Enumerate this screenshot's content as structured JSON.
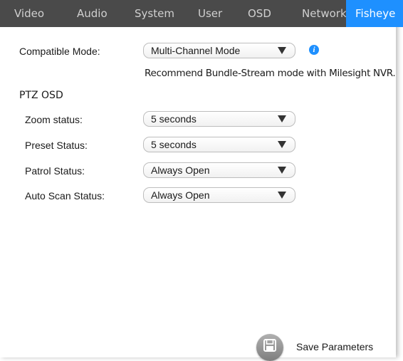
{
  "tabs": [
    {
      "label": "Video",
      "active": false
    },
    {
      "label": "Audio",
      "active": false
    },
    {
      "label": "System",
      "active": false
    },
    {
      "label": "User",
      "active": false
    },
    {
      "label": "OSD",
      "active": false
    },
    {
      "label": "Network",
      "active": false
    },
    {
      "label": "Fisheye",
      "active": true
    }
  ],
  "compatible_mode": {
    "label": "Compatible Mode:",
    "value": "Multi-Channel Mode",
    "info_icon": "info-icon",
    "note": "Recommend Bundle-Stream mode with Milesight NVR."
  },
  "ptz_osd": {
    "title": "PTZ OSD",
    "rows": [
      {
        "label": "Zoom status:",
        "value": "5 seconds"
      },
      {
        "label": "Preset Status:",
        "value": "5 seconds"
      },
      {
        "label": "Patrol Status:",
        "value": "Always Open"
      },
      {
        "label": "Auto Scan Status:",
        "value": "Always Open"
      }
    ]
  },
  "footer": {
    "save_label": "Save Parameters",
    "save_icon": "floppy-disk-icon"
  },
  "colors": {
    "tab_bar": "#4a4a4a",
    "active_tab": "#1e90ff",
    "info_icon": "#1e90ff"
  }
}
